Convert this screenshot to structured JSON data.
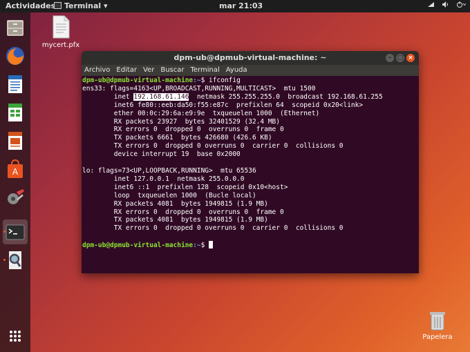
{
  "topbar": {
    "activities": "Actividades",
    "app_name": "Terminal ▾",
    "clock": "mar 21:03",
    "tray_icons": [
      "network-icon",
      "volume-icon",
      "power-icon"
    ]
  },
  "desktop": {
    "file_label": "mycert.pfx",
    "trash_label": "Papelera"
  },
  "window": {
    "title": "dpm-ub@dpmub-virtual-machine: ~",
    "menu": [
      "Archivo",
      "Editar",
      "Ver",
      "Buscar",
      "Terminal",
      "Ayuda"
    ]
  },
  "terminal": {
    "prompt_user": "dpm-ub@dpmub-virtual-machine",
    "prompt_path": ":~",
    "command": "$ ifconfig",
    "iface1_header": "ens33: flags=4163<UP,BROADCAST,RUNNING,MULTICAST>  mtu 1500",
    "inet_prefix": "        inet ",
    "inet_ip": "192.168.61.146",
    "inet_rest": "  netmask 255.255.255.0  broadcast 192.168.61.255",
    "iface1_lines": [
      "        inet6 fe80::eeb:da50:f55:e87c  prefixlen 64  scopeid 0x20<link>",
      "        ether 00:0c:29:6a:e9:9e  txqueuelen 1000  (Ethernet)",
      "        RX packets 23927  bytes 32401529 (32.4 MB)",
      "        RX errors 0  dropped 0  overruns 0  frame 0",
      "        TX packets 6661  bytes 426680 (426.6 KB)",
      "        TX errors 0  dropped 0 overruns 0  carrier 0  collisions 0",
      "        device interrupt 19  base 0x2000"
    ],
    "iface2_lines": [
      "lo: flags=73<UP,LOOPBACK,RUNNING>  mtu 65536",
      "        inet 127.0.0.1  netmask 255.0.0.0",
      "        inet6 ::1  prefixlen 128  scopeid 0x10<host>",
      "        loop  txqueuelen 1000  (Bucle local)",
      "        RX packets 4081  bytes 1949815 (1.9 MB)",
      "        RX errors 0  dropped 0  overruns 0  frame 0",
      "        TX packets 4081  bytes 1949815 (1.9 MB)",
      "        TX errors 0  dropped 0 overruns 0  carrier 0  collisions 0"
    ],
    "prompt_end": "$ "
  },
  "colors": {
    "terminal_bg": "#300a24",
    "prompt_user": "#8ae234",
    "prompt_path": "#729fcf",
    "accent": "#e95420"
  }
}
